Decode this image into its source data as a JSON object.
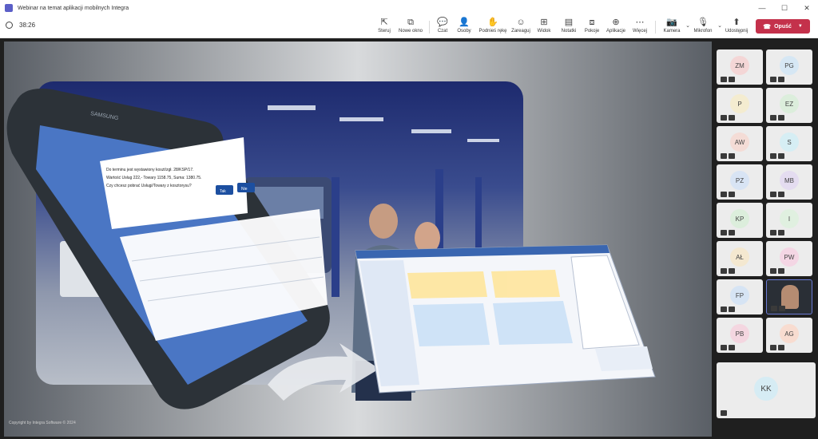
{
  "window": {
    "title": "Webinar na temat aplikacji mobilnych Integra"
  },
  "meeting": {
    "timer": "38:26"
  },
  "toolbar": {
    "buttons": [
      {
        "label": "Steruj",
        "icon": "control-icon"
      },
      {
        "label": "Nowe okno",
        "icon": "new-window-icon"
      },
      {
        "label": "Czat",
        "icon": "chat-icon"
      },
      {
        "label": "Osoby",
        "icon": "people-icon"
      },
      {
        "label": "Podnieś rękę",
        "icon": "raise-hand-icon"
      },
      {
        "label": "Zareaguj",
        "icon": "react-icon"
      },
      {
        "label": "Widok",
        "icon": "view-icon"
      },
      {
        "label": "Notatki",
        "icon": "notes-icon"
      },
      {
        "label": "Pokoje",
        "icon": "rooms-icon"
      },
      {
        "label": "Aplikacje",
        "icon": "apps-icon"
      },
      {
        "label": "Więcej",
        "icon": "more-icon"
      },
      {
        "label": "Kamera",
        "icon": "camera-off-icon"
      },
      {
        "label": "Mikrofon",
        "icon": "mic-off-icon"
      },
      {
        "label": "Udostępnij",
        "icon": "share-icon"
      }
    ],
    "leave_label": "Opuść",
    "leave_color": "#c4314b"
  },
  "share": {
    "copyright": "Copyright by Integra Software © 2024",
    "dialog_text": "Do terminu jest wystawiony koszt/zgł. 28/KSP/17. Wartość Usług 222,- Towary 1158.75, Suma: 1380.75. Czy chcesz pobrać Usługi/Towary z kosztorysu?",
    "dialog_yes": "Tak",
    "dialog_no": "Nie",
    "brand": "SAMSUNG"
  },
  "participants": [
    {
      "initials": "ZM",
      "color": "#f4d6d6"
    },
    {
      "initials": "PG",
      "color": "#d6e7f4"
    },
    {
      "initials": "P",
      "color": "#f4ecd0"
    },
    {
      "initials": "EZ",
      "color": "#dceedc"
    },
    {
      "initials": "AW",
      "color": "#f4dcd6"
    },
    {
      "initials": "S",
      "color": "#d6eef4"
    },
    {
      "initials": "PZ",
      "color": "#d8e4f4"
    },
    {
      "initials": "MB",
      "color": "#e4dcf0"
    },
    {
      "initials": "KP",
      "color": "#dceedc"
    },
    {
      "initials": "I",
      "color": "#e0f0e0"
    },
    {
      "initials": "AŁ",
      "color": "#f4e8d0"
    },
    {
      "initials": "PW",
      "color": "#f4d6e4"
    },
    {
      "initials": "FP",
      "color": "#d6e4f4"
    },
    {
      "initials": "",
      "color": "#2a2f36"
    },
    {
      "initials": "PB",
      "color": "#f4d6e0"
    },
    {
      "initials": "AG",
      "color": "#f8dcd0"
    },
    {
      "initials": "KK",
      "color": "#d6ecf4"
    }
  ]
}
